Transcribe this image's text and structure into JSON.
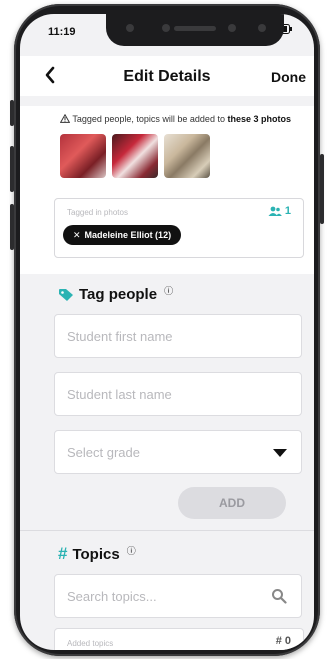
{
  "status_bar": {
    "time": "11:19"
  },
  "nav": {
    "back_icon": "chevron-left-icon",
    "title": "Edit Details",
    "done_label": "Done"
  },
  "notice": {
    "prefix": "Tagged people, topics will be added to",
    "emphasis": "these 3 photos"
  },
  "tagged": {
    "label": "Tagged in photos",
    "count": "1",
    "chip_label": "Madeleine Elliot (12)"
  },
  "tag_people": {
    "title": "Tag people",
    "first_name_placeholder": "Student first name",
    "last_name_placeholder": "Student last name",
    "grade_placeholder": "Select grade",
    "add_label": "ADD"
  },
  "topics": {
    "title": "Topics",
    "search_placeholder": "Search topics...",
    "added_label": "Added topics",
    "added_count": "# 0"
  },
  "colors": {
    "accent": "#2bb3b3",
    "chip_bg": "#111111",
    "button_disabled": "#dcdce0"
  }
}
